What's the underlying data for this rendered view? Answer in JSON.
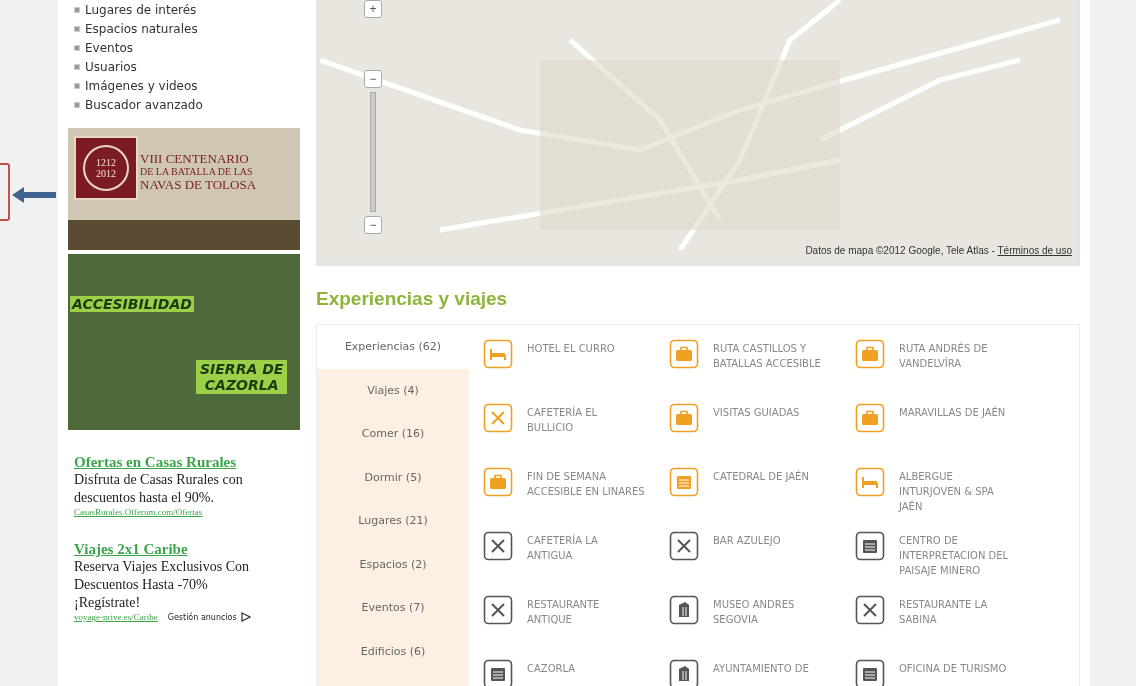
{
  "sidebar": {
    "menu": [
      "Lugares de interés",
      "Espacios naturales",
      "Eventos",
      "Usuarios",
      "Imágenes y videos",
      "Buscador avanzado"
    ],
    "banners": [
      {
        "kind": "centenario",
        "texts": [
          "1212",
          "2012",
          "VIII CENTENARIO",
          "DE LA BATALLA DE LAS",
          "NAVAS DE TOLOSA"
        ]
      },
      {
        "kind": "accesibilidad",
        "texts": [
          "ACCESIBILIDAD",
          "SIERRA DE",
          "CAZORLA"
        ]
      }
    ],
    "ads": [
      {
        "title": "Ofertas en Casas Rurales",
        "lines": [
          "Disfruta de Casas Rurales con descuentos hasta el 90%."
        ],
        "url": "CasasRurales.Offerum.com/Ofertas"
      },
      {
        "title": "Viajes 2x1 Caribe",
        "lines": [
          "Reserva Viajes Exclusivos Con Descuentos Hasta -70%",
          "¡Regístrate!"
        ],
        "url": "voyage-prive.es/Caribe"
      }
    ],
    "ad_choices": "Gestión anuncios"
  },
  "map": {
    "zoom_in": "+",
    "zoom_out": "−",
    "zoom_min": "−",
    "attribution": "Datos de mapa ©2012 Google, Tele Atlas - ",
    "terms_link": "Términos de uso"
  },
  "section_title": "Experiencias y viajes",
  "tabs": [
    {
      "label": "Experiencias (62)",
      "selected": true
    },
    {
      "label": "Viajes (4)",
      "selected": false
    },
    {
      "label": "Comer (16)",
      "selected": false
    },
    {
      "label": "Dormir (5)",
      "selected": false
    },
    {
      "label": "Lugares (21)",
      "selected": false
    },
    {
      "label": "Espacios (2)",
      "selected": false
    },
    {
      "label": "Eventos (7)",
      "selected": false
    },
    {
      "label": "Edificios (6)",
      "selected": false
    }
  ],
  "items": [
    {
      "kind": "bed",
      "color": "#f0a020",
      "name": "HOTEL EL CURRO"
    },
    {
      "kind": "suitcase",
      "color": "#f0a020",
      "name": "RUTA CASTILLOS Y BATALLAS ACCESIBLE"
    },
    {
      "kind": "suitcase",
      "color": "#f0a020",
      "name": "RUTA ANDRÉS DE VANDELVÍRA"
    },
    {
      "kind": "food",
      "color": "#f0a020",
      "name": "CAFETERÍA EL BULLICIO"
    },
    {
      "kind": "suitcase",
      "color": "#f0a020",
      "name": "VISITAS GUIADAS"
    },
    {
      "kind": "suitcase",
      "color": "#f0a020",
      "name": "MARAVILLAS DE JAÉN"
    },
    {
      "kind": "suitcase",
      "color": "#f0a020",
      "name": "FIN DE SEMANA ACCESIBLE EN LINARES"
    },
    {
      "kind": "building",
      "color": "#f0a020",
      "name": "CATEDRAL DE JAÉN"
    },
    {
      "kind": "bed",
      "color": "#f0a020",
      "name": "ALBERGUE INTURJOVEN & SPA JAÉN"
    },
    {
      "kind": "food",
      "color": "#555555",
      "name": "CAFETERÍA LA ANTIGUA"
    },
    {
      "kind": "food",
      "color": "#555555",
      "name": "BAR AZULEJO"
    },
    {
      "kind": "building",
      "color": "#555555",
      "name": "CENTRO DE INTERPRETACION DEL PAISAJE MINERO"
    },
    {
      "kind": "food",
      "color": "#555555",
      "name": "RESTAURANTE ANTIQUE"
    },
    {
      "kind": "museum",
      "color": "#555555",
      "name": "MUSEO ANDRES SEGOVIA"
    },
    {
      "kind": "food",
      "color": "#555555",
      "name": "RESTAURANTE LA SABINA"
    },
    {
      "kind": "building",
      "color": "#555555",
      "name": "CAZORLA"
    },
    {
      "kind": "museum",
      "color": "#555555",
      "name": "AYUNTAMIENTO DE"
    },
    {
      "kind": "building",
      "color": "#555555",
      "name": "OFICINA DE TURISMO"
    }
  ]
}
